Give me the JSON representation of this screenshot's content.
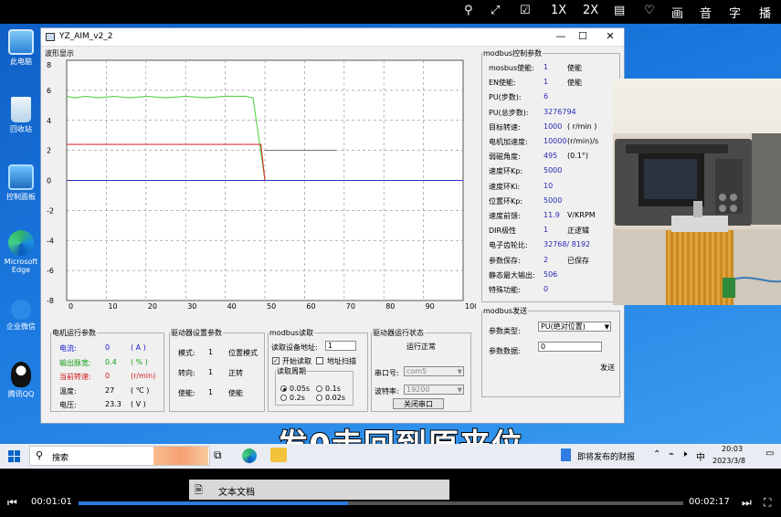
{
  "player": {
    "top_icons": [
      "pin-icon",
      "expand-icon",
      "edit-icon",
      "1X",
      "2X",
      "layout-icon",
      "bulb-icon",
      "画",
      "音",
      "字",
      "播"
    ],
    "current_time": "00:01:01",
    "total_time": "00:02:17",
    "progress": 0.445,
    "playlist_item": "文本文档"
  },
  "subtitle": "发0走回到原来位置",
  "desktop_icons": [
    {
      "label": "此电脑",
      "icon": "computer-icon"
    },
    {
      "label": "回收站",
      "icon": "recycle-bin-icon"
    },
    {
      "label": "控制面板",
      "icon": "control-panel-icon"
    },
    {
      "label": "Microsoft Edge",
      "icon": "edge-icon"
    },
    {
      "label": "企业微信",
      "icon": "wecom-icon"
    },
    {
      "label": "腾讯QQ",
      "icon": "qq-icon"
    }
  ],
  "window": {
    "title": "YZ_AIM_v2_2",
    "chart_title": "波形显示"
  },
  "chart_data": {
    "type": "line",
    "xlim": [
      0,
      100
    ],
    "ylim": [
      -8,
      8
    ],
    "x_ticks": [
      "0",
      "10",
      "20",
      "30",
      "40",
      "50",
      "60",
      "70",
      "80",
      "90",
      "100"
    ],
    "y_ticks": [
      "8",
      "6",
      "4",
      "2",
      "0",
      "-2",
      "-4",
      "-6",
      "-8"
    ],
    "grid": true,
    "series": [
      {
        "color": "#59d14a",
        "x": [
          0,
          2,
          5,
          8,
          12,
          16,
          20,
          25,
          30,
          35,
          40,
          45,
          47,
          50
        ],
        "y": [
          5.6,
          5.5,
          5.6,
          5.5,
          5.6,
          5.5,
          5.6,
          5.5,
          5.6,
          5.5,
          5.6,
          5.6,
          5.5,
          0
        ]
      },
      {
        "color": "#e03030",
        "x": [
          0,
          49,
          50
        ],
        "y": [
          2.4,
          2.4,
          0
        ]
      },
      {
        "color": "#6a6a6a",
        "x": [
          50,
          68
        ],
        "y": [
          2.0,
          2.0
        ]
      },
      {
        "color": "#3030c0",
        "x": [
          0,
          100
        ],
        "y": [
          0,
          0
        ]
      }
    ]
  },
  "motor_params": {
    "title": "电机运行参数",
    "rows": [
      {
        "label": "电流:",
        "value": "0",
        "unit": "( A )",
        "color": "#1a1ad0"
      },
      {
        "label": "输出脉宽:",
        "value": "0.4",
        "unit": "( % )",
        "color": "#14a014"
      },
      {
        "label": "当前转速:",
        "value": "0",
        "unit": "(r/min)",
        "color": "#d01818"
      },
      {
        "label": "温度:",
        "value": "27",
        "unit": "( ℃ )",
        "color": "#000000"
      },
      {
        "label": "电压:",
        "value": "23.3",
        "unit": "( V )",
        "color": "#000000"
      }
    ]
  },
  "driver_settings": {
    "title": "驱动器设置参数",
    "rows": [
      {
        "label": "模式:",
        "value": "1",
        "desc": "位置模式"
      },
      {
        "label": "转向:",
        "value": "1",
        "desc": "正转"
      },
      {
        "label": "使能:",
        "value": "1",
        "desc": "使能"
      }
    ]
  },
  "modbus_read": {
    "title": "modbus读取",
    "address_label": "读取设备地址:",
    "address_value": "1",
    "start_read_label": "开始读取",
    "start_read_checked": true,
    "scan_label": "地址扫描",
    "scan_checked": false,
    "period_title": "读取周期",
    "periods": [
      {
        "label": "0.05s",
        "checked": true
      },
      {
        "label": "0.1s",
        "checked": false
      },
      {
        "label": "0.2s",
        "checked": false
      },
      {
        "label": "0.02s",
        "checked": false
      }
    ]
  },
  "driver_status": {
    "title": "驱动器运行状态",
    "status": "运行正常",
    "port_label": "串口号:",
    "port_value": "com5",
    "baud_label": "波特率:",
    "baud_value": "19200",
    "close_button": "关闭串口"
  },
  "modbus_params": {
    "title": "modbus控制参数",
    "rows": [
      {
        "label": "mosbus使能:",
        "value": "1",
        "desc": "使能"
      },
      {
        "label": "EN使能:",
        "value": "1",
        "desc": "使能"
      },
      {
        "label": "PU(步数):",
        "value": "6",
        "desc": ""
      },
      {
        "label": "PU(总步数):",
        "value": "3276794",
        "desc": ""
      },
      {
        "label": "目标转速:",
        "value": "1000",
        "desc": "( r/min )"
      },
      {
        "label": "电机加速度:",
        "value": "10000",
        "desc": "(r/min)/s"
      },
      {
        "label": "弱磁角度:",
        "value": "495",
        "desc": "(0.1°)"
      },
      {
        "label": "速度环Kp:",
        "value": "5000",
        "desc": ""
      },
      {
        "label": "速度环Ki:",
        "value": "10",
        "desc": ""
      },
      {
        "label": "位置环Kp:",
        "value": "5000",
        "desc": ""
      },
      {
        "label": "速度前馈:",
        "value": "11.9",
        "desc": "V/KRPM"
      },
      {
        "label": "DIR极性",
        "value": "1",
        "desc": "正逻辑"
      },
      {
        "label": "电子齿轮比:",
        "value": "32768/ 8192",
        "desc": ""
      },
      {
        "label": "参数保存:",
        "value": "2",
        "desc": "已保存"
      },
      {
        "label": "静态最大输出:",
        "value": "506",
        "desc": ""
      },
      {
        "label": "特殊功能:",
        "value": "0",
        "desc": ""
      }
    ]
  },
  "modbus_send": {
    "title": "modbus发送",
    "type_label": "参数类型:",
    "type_value": "PU(绝对位置)",
    "data_label": "参数数据:",
    "data_value": "0",
    "send_button": "发送"
  },
  "taskbar": {
    "search_placeholder": "搜索",
    "news": "即将发布的财报",
    "ime": "中",
    "time": "20:03",
    "date": "2023/3/8"
  }
}
